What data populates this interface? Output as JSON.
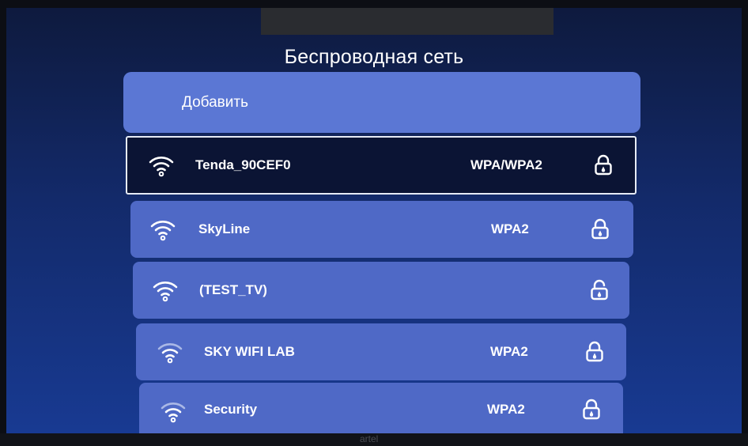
{
  "screen": {
    "title": "Беспроводная сеть",
    "add_label": "Добавить"
  },
  "networks": [
    {
      "ssid": "Tenda_90CEF0",
      "security": "WPA/WPA2",
      "selected": true,
      "icon": "wifi-icon",
      "lock": "lock-icon"
    },
    {
      "ssid": "SkyLine",
      "security": "WPA2",
      "selected": false,
      "icon": "wifi-icon",
      "lock": "lock-icon"
    },
    {
      "ssid": "(TEST_TV)",
      "security": "",
      "selected": false,
      "icon": "wifi-icon",
      "lock": "lock-open-icon"
    },
    {
      "ssid": "SKY WIFI LAB",
      "security": "WPA2",
      "selected": false,
      "icon": "wifi-icon",
      "lock": "lock-icon"
    },
    {
      "ssid": "Security",
      "security": "WPA2",
      "selected": false,
      "icon": "wifi-icon",
      "lock": "lock-icon"
    }
  ],
  "bezel": {
    "brand": "artel"
  },
  "colors": {
    "background_top": "#0e1a3e",
    "background_bottom": "#183a92",
    "row": "#4f69c6",
    "add_button": "#5b77d4",
    "selected_row": "#0b1434"
  }
}
